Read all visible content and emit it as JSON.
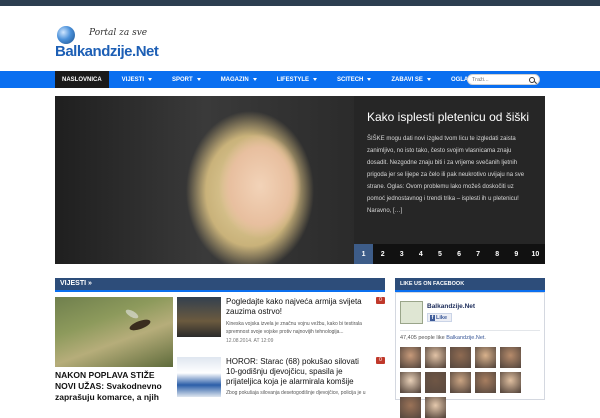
{
  "site": {
    "tagline": "Portal za sve",
    "name": "Balkandzije.Net"
  },
  "nav": {
    "items": [
      {
        "label": "NASLOVNICA",
        "active": true,
        "dropdown": false
      },
      {
        "label": "VIJESTI",
        "active": false,
        "dropdown": true
      },
      {
        "label": "SPORT",
        "active": false,
        "dropdown": true
      },
      {
        "label": "MAGAZIN",
        "active": false,
        "dropdown": true
      },
      {
        "label": "LIFESTYLE",
        "active": false,
        "dropdown": true
      },
      {
        "label": "SCITECH",
        "active": false,
        "dropdown": true
      },
      {
        "label": "ZABAVI SE",
        "active": false,
        "dropdown": true
      },
      {
        "label": "OGLASI",
        "active": false,
        "dropdown": true
      }
    ],
    "search_placeholder": "Traži..."
  },
  "slider": {
    "title": "Kako isplesti pletenicu od šiški",
    "excerpt": "ŠIŠKE mogu dati novi izgled tvom licu te izgledati zaista zanimljivo, no isto tako, često svojim vlasnicama znaju dosadit. Nezgodne znaju biti i za vrijeme svečanih ljetnih prigoda jer se lijepe za čelo ili pak neukrotivo uvijaju na sve strane. Oglas: Ovom problemu lako možeš doskočiti uz pomoć jednostavnog i trendi trika – isplesti ih u pletenicu! Naravno, […]",
    "pages": [
      "1",
      "2",
      "3",
      "4",
      "5",
      "6",
      "7",
      "8",
      "9",
      "10"
    ],
    "active_page": "1"
  },
  "news": {
    "section_title": "VIJESTI »",
    "featured_title": "NAKON POPLAVA STIŽE NOVI UŽAS: Svakodnevno zaprašuju komarce, a njih",
    "posts": [
      {
        "title": "Pogledajte kako najveća armija svijeta zauzima ostrvo!",
        "excerpt": "Kineska vojska izvela je značnu vojnu vežbu, kako bi testirala spremnost svoje vojske protiv najnovijih tehnologija...",
        "date": "12.08.2014. AT 12:09",
        "comments": "0"
      },
      {
        "title": "HOROR: Starac (68) pokušao silovati 10-godišnju djevojčicu, spasila je prijateljica koja je alarmirala komšije",
        "excerpt": "Zbog pokušaja silovanja desetogodišnje djevojčice, policija je u",
        "date": "",
        "comments": "0"
      }
    ]
  },
  "facebook": {
    "header": "LIKE US ON FACEBOOK",
    "page_name": "Balkandzije.Net",
    "like_label": "Like",
    "count_text": "47,405 people like",
    "count_link": "Balkandzije.Net",
    "count_end": ".",
    "faces": [
      "",
      "",
      "",
      "",
      "",
      "",
      "",
      "",
      "",
      "",
      "",
      ""
    ]
  },
  "colors": {
    "nav_blue": "#0a6ff0",
    "section_bar": "#2d4d7a",
    "slider_bg": "#262626",
    "pager_active": "#3d5c88",
    "badge_red": "#c0392b"
  }
}
